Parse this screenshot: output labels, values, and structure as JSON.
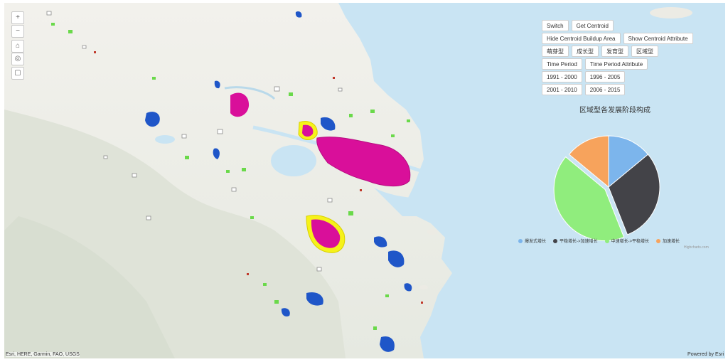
{
  "map": {
    "attribution": "Esri, HERE, Garmin, FAO, USGS",
    "powered_by": "Powered by Esri",
    "zoom_controls": [
      "zoom-in",
      "zoom-out",
      "home",
      "locate",
      "fullscreen"
    ]
  },
  "buttons": {
    "switch": "Switch",
    "get_centroid": "Get Centroid",
    "hide_centroid_buildup_area": "Hide Centroid Buildup Area",
    "show_centroid_attribute": "Show Centroid Attribute",
    "type_sprout": "萌芽型",
    "type_growth": "成长型",
    "type_develop": "发育型",
    "type_region": "区域型",
    "time_period": "Time Period",
    "time_period_attribute": "Time Period Attribute",
    "period_1991_2000": "1991 - 2000",
    "period_1996_2005": "1996 - 2005",
    "period_2001_2010": "2001 - 2010",
    "period_2006_2015": "2006 - 2015"
  },
  "chart_data": {
    "type": "pie",
    "title": "区域型各发展阶段构成",
    "series": [
      {
        "name": "爆发式增长",
        "value": 14,
        "color": "#7cb5ec"
      },
      {
        "name": "平稳增长->加速增长",
        "value": 30,
        "color": "#434348"
      },
      {
        "name": "中速增长->平稳增长",
        "value": 42,
        "color": "#90ed7d"
      },
      {
        "name": "加速增长",
        "value": 14,
        "color": "#f7a35c"
      }
    ],
    "credit": "Highcharts.com",
    "legend_position": "bottom"
  }
}
